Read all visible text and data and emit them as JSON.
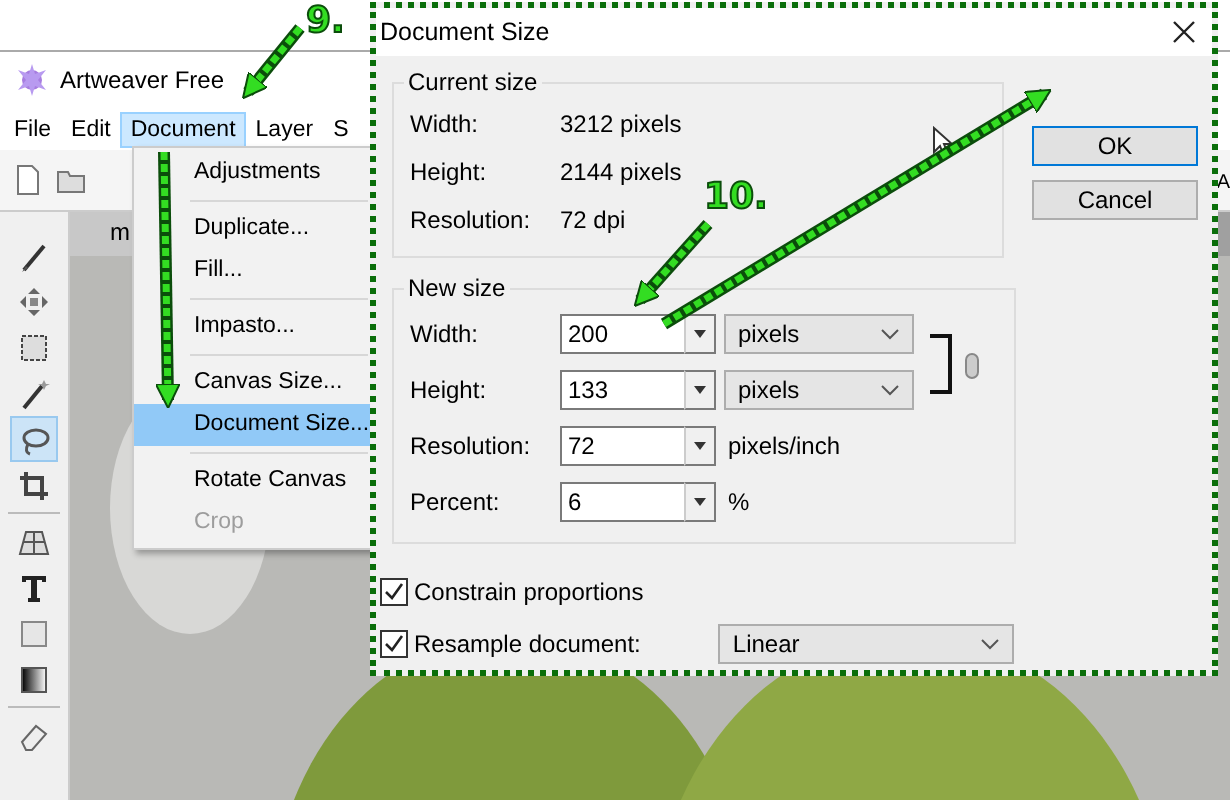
{
  "app": {
    "title": "Artweaver Free",
    "menu": [
      {
        "label": "File",
        "selected": false
      },
      {
        "label": "Edit",
        "selected": false
      },
      {
        "label": "Document",
        "selected": true
      },
      {
        "label": "Layer",
        "selected": false
      },
      {
        "label": "S",
        "selected": false
      }
    ],
    "document_tab": "m",
    "side_label": "A",
    "tools": [
      {
        "kind": "brush",
        "selected": false
      },
      {
        "kind": "move",
        "selected": false
      },
      {
        "kind": "marquee",
        "selected": false
      },
      {
        "kind": "wand",
        "selected": false
      },
      {
        "kind": "lasso",
        "selected": true
      },
      {
        "kind": "crop",
        "selected": false
      },
      {
        "kind": "perspective",
        "selected": false
      },
      {
        "kind": "text",
        "selected": false
      },
      {
        "kind": "rectangle",
        "selected": false
      },
      {
        "kind": "gradient",
        "selected": false
      },
      {
        "kind": "eraser",
        "selected": false
      }
    ]
  },
  "document_menu": [
    {
      "label": "Adjustments",
      "selected": false,
      "disabled": false,
      "separator_after": true
    },
    {
      "label": "Duplicate...",
      "selected": false,
      "disabled": false,
      "separator_after": false
    },
    {
      "label": "Fill...",
      "selected": false,
      "disabled": false,
      "separator_after": true
    },
    {
      "label": "Impasto...",
      "selected": false,
      "disabled": false,
      "separator_after": true
    },
    {
      "label": "Canvas Size...",
      "selected": false,
      "disabled": false,
      "separator_after": false
    },
    {
      "label": "Document Size...",
      "selected": true,
      "disabled": false,
      "separator_after": true
    },
    {
      "label": "Rotate Canvas",
      "selected": false,
      "disabled": false,
      "separator_after": false
    },
    {
      "label": "Crop",
      "selected": false,
      "disabled": true,
      "separator_after": false
    }
  ],
  "dialog": {
    "title": "Document Size",
    "current_size": {
      "title": "Current size",
      "rows": [
        {
          "label": "Width:",
          "value": "3212 pixels"
        },
        {
          "label": "Height:",
          "value": "2144 pixels"
        },
        {
          "label": "Resolution:",
          "value": "72 dpi"
        }
      ]
    },
    "new_size": {
      "title": "New size",
      "rows": [
        {
          "label": "Width:",
          "value": "200",
          "unit": "pixels",
          "kind": "select"
        },
        {
          "label": "Height:",
          "value": "133",
          "unit": "pixels",
          "kind": "select"
        },
        {
          "label": "Resolution:",
          "value": "72",
          "unit": "pixels/inch",
          "kind": "text"
        },
        {
          "label": "Percent:",
          "value": "6",
          "unit": "%",
          "kind": "text"
        }
      ]
    },
    "constrain": {
      "label": "Constrain proportions",
      "checked": true
    },
    "resample": {
      "label": "Resample document:",
      "checked": true,
      "method": "Linear"
    },
    "buttons": [
      "OK",
      "Cancel"
    ]
  },
  "annotations": [
    {
      "label": "9."
    },
    {
      "label": "10."
    }
  ]
}
